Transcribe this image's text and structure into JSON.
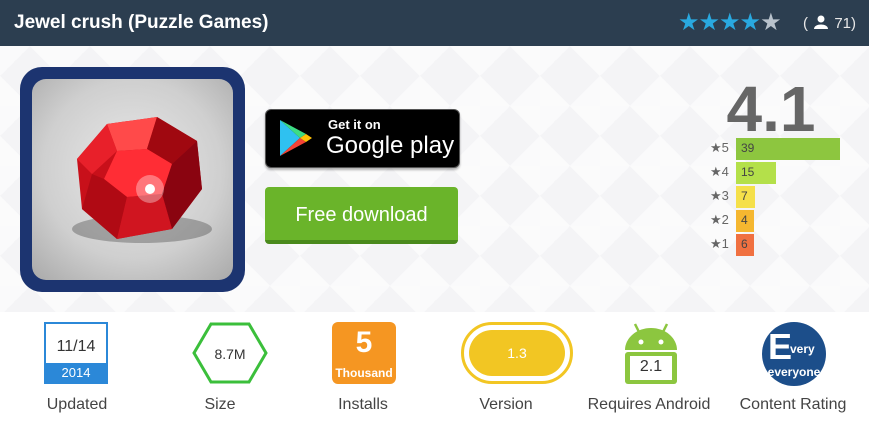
{
  "header": {
    "title": "Jewel crush (Puzzle Games)",
    "rating_stars": 4,
    "votes_prefix": "(",
    "votes_count": "71)"
  },
  "hero": {
    "gplay_small": "Get it on",
    "gplay_big": "Google play",
    "free_download": "Free download",
    "rating": "4.1",
    "distribution": [
      {
        "label": "★5",
        "count": "39",
        "value": 39,
        "color": "#8dc63f"
      },
      {
        "label": "★4",
        "count": "15",
        "value": 15,
        "color": "#b4e04a"
      },
      {
        "label": "★3",
        "count": "7",
        "value": 7,
        "color": "#f5e04a"
      },
      {
        "label": "★2",
        "count": "4",
        "value": 4,
        "color": "#f5b730"
      },
      {
        "label": "★1",
        "count": "6",
        "value": 6,
        "color": "#f07040"
      }
    ]
  },
  "stats": {
    "updated": {
      "date": "11/14",
      "year": "2014",
      "caption": "Updated"
    },
    "size": {
      "value": "8.7M",
      "caption": "Size"
    },
    "installs": {
      "number": "5",
      "unit": "Thousand",
      "caption": "Installs"
    },
    "version": {
      "value": "1.3",
      "caption": "Version"
    },
    "android": {
      "value": "2.1",
      "caption": "Requires Android"
    },
    "content_rating": {
      "letter": "E",
      "rest": "very",
      "label": "everyone",
      "caption": "Content Rating"
    }
  }
}
